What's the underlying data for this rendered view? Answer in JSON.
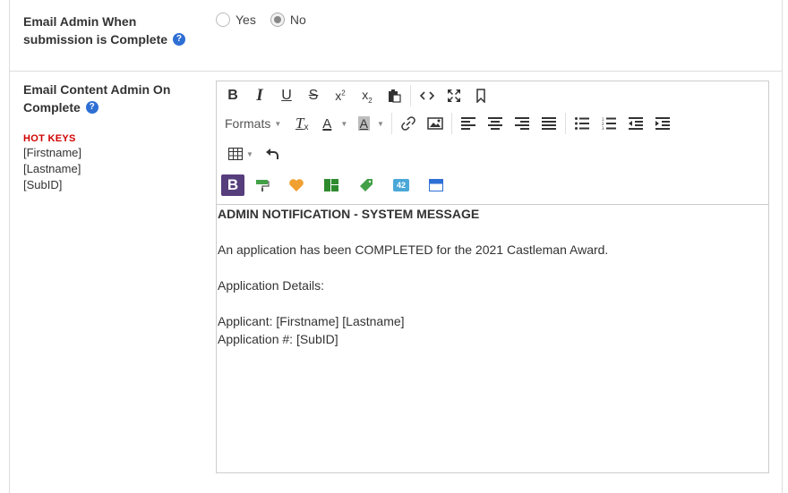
{
  "email_admin": {
    "label_line1": "Email Admin When",
    "label_line2": "submission is Complete",
    "help_glyph": "?",
    "options": [
      {
        "label": "Yes",
        "checked": false
      },
      {
        "label": "No",
        "checked": true
      }
    ]
  },
  "email_content": {
    "label_line1": "Email Content Admin On",
    "label_line2": "Complete",
    "help_glyph": "?",
    "hotkeys_title": "HOT KEYS",
    "hotkeys": [
      "[Firstname]",
      "[Lastname]",
      "[SubID]"
    ]
  },
  "editor": {
    "formats_label": "Formats",
    "plugin_colors": {
      "bootstrap": "#563d7c",
      "paint": "#43a047",
      "heart": "#f0a030",
      "layout": "#2e8b2e",
      "tag": "#43a047",
      "badge": "#4aa8d8",
      "window": "#2e6fd4"
    },
    "badge_text": "42",
    "bootstrap_text": "B",
    "content": {
      "heading": "ADMIN NOTIFICATION - SYSTEM MESSAGE",
      "line1": "An application has been COMPLETED for the 2021 Castleman Award.",
      "line2": "Application Details:",
      "line3": "Applicant: [Firstname] [Lastname]",
      "line4": "Application #: [SubID]"
    }
  }
}
